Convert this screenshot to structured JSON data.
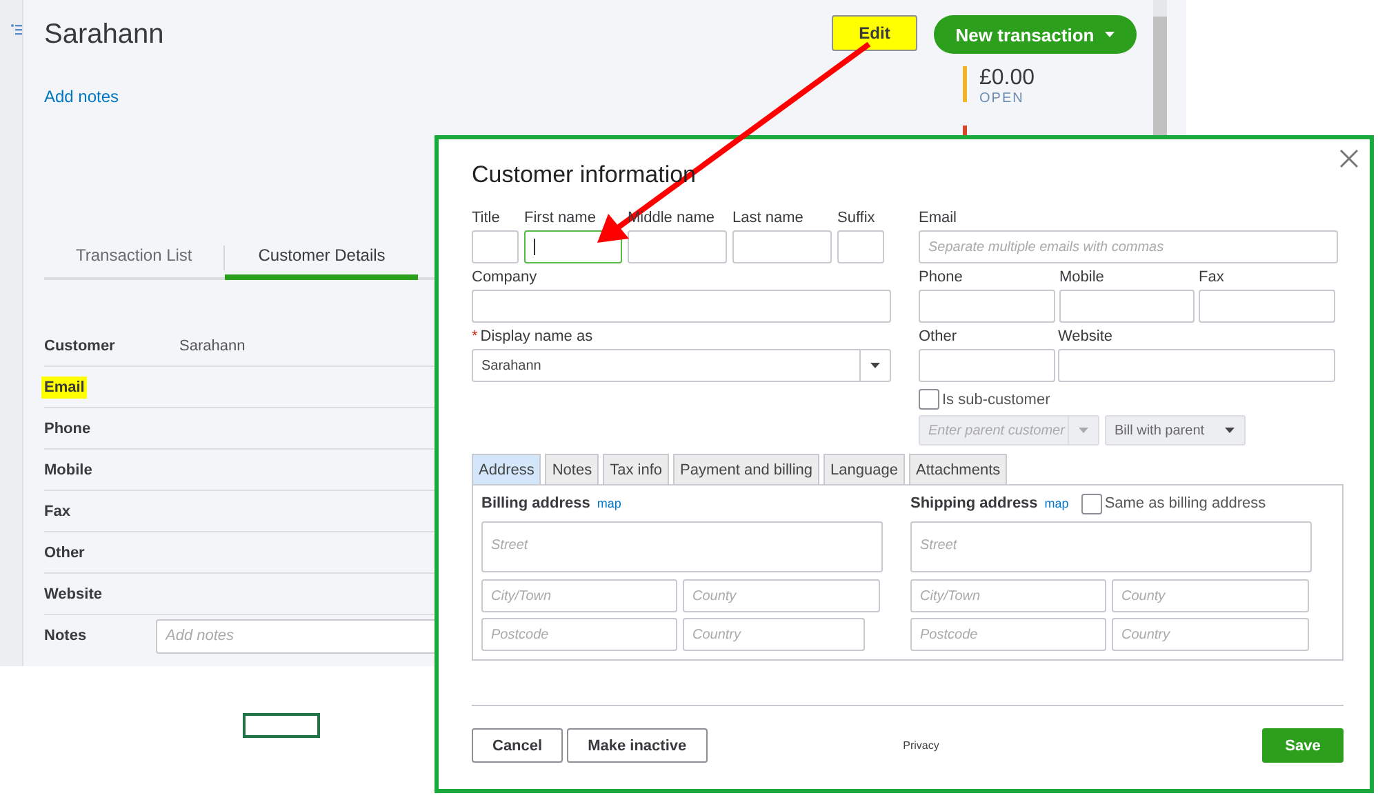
{
  "page": {
    "title": "Sarahann",
    "add_notes_link": "Add notes",
    "edit_button": {
      "label": "Edit",
      "highlighted": true
    },
    "new_transaction_button": {
      "label": "New transaction"
    },
    "balances": [
      {
        "amount": "£0.00",
        "label": "OPEN",
        "color": "#f0b429"
      },
      {
        "color": "#d9472b"
      }
    ],
    "tabs": [
      {
        "label": "Transaction List",
        "selected": false
      },
      {
        "label": "Customer Details",
        "selected": true
      }
    ],
    "details": [
      {
        "label": "Customer",
        "value": "Sarahann",
        "highlighted": false
      },
      {
        "label": "Email",
        "highlighted": true
      },
      {
        "label": "Phone",
        "highlighted": false
      },
      {
        "label": "Mobile",
        "highlighted": false
      },
      {
        "label": "Fax",
        "highlighted": false
      },
      {
        "label": "Other",
        "highlighted": false
      },
      {
        "label": "Website",
        "highlighted": false
      },
      {
        "label": "Notes",
        "placeholder": "Add notes",
        "highlighted": false
      }
    ]
  },
  "dialog": {
    "title": "Customer information",
    "name_fields": [
      {
        "label": "Title",
        "focused": false
      },
      {
        "label": "First name",
        "focused": true
      },
      {
        "label": "Middle name",
        "focused": false
      },
      {
        "label": "Last name",
        "focused": false
      },
      {
        "label": "Suffix",
        "focused": false
      }
    ],
    "company": {
      "label": "Company"
    },
    "display_name": {
      "label": "Display name as",
      "required_mark": "*",
      "value": "Sarahann"
    },
    "email": {
      "label": "Email",
      "placeholder": "Separate multiple emails with commas"
    },
    "phone_fields": [
      {
        "label": "Phone"
      },
      {
        "label": "Mobile"
      },
      {
        "label": "Fax"
      }
    ],
    "other_fields": [
      {
        "label": "Other"
      },
      {
        "label": "Website"
      }
    ],
    "sub_customer": {
      "label": "Is sub-customer",
      "checked": false
    },
    "parent_customer": {
      "placeholder": "Enter parent customer"
    },
    "bill_with": {
      "value": "Bill with parent"
    },
    "tabs": [
      {
        "label": "Address",
        "selected": true
      },
      {
        "label": "Notes",
        "selected": false
      },
      {
        "label": "Tax info",
        "selected": false
      },
      {
        "label": "Payment and billing",
        "selected": false
      },
      {
        "label": "Language",
        "selected": false
      },
      {
        "label": "Attachments",
        "selected": false
      }
    ],
    "billing": {
      "title": "Billing address",
      "map_link": "map",
      "street": "Street",
      "city": "City/Town",
      "county": "County",
      "postcode": "Postcode",
      "country": "Country"
    },
    "shipping": {
      "title": "Shipping address",
      "map_link": "map",
      "same_as_billing": {
        "label": "Same as billing address",
        "checked": false
      },
      "street": "Street",
      "city": "City/Town",
      "county": "County",
      "postcode": "Postcode",
      "country": "Country"
    },
    "buttons": {
      "cancel": "Cancel",
      "make_inactive": "Make inactive",
      "save": "Save"
    },
    "privacy_link": "Privacy"
  }
}
